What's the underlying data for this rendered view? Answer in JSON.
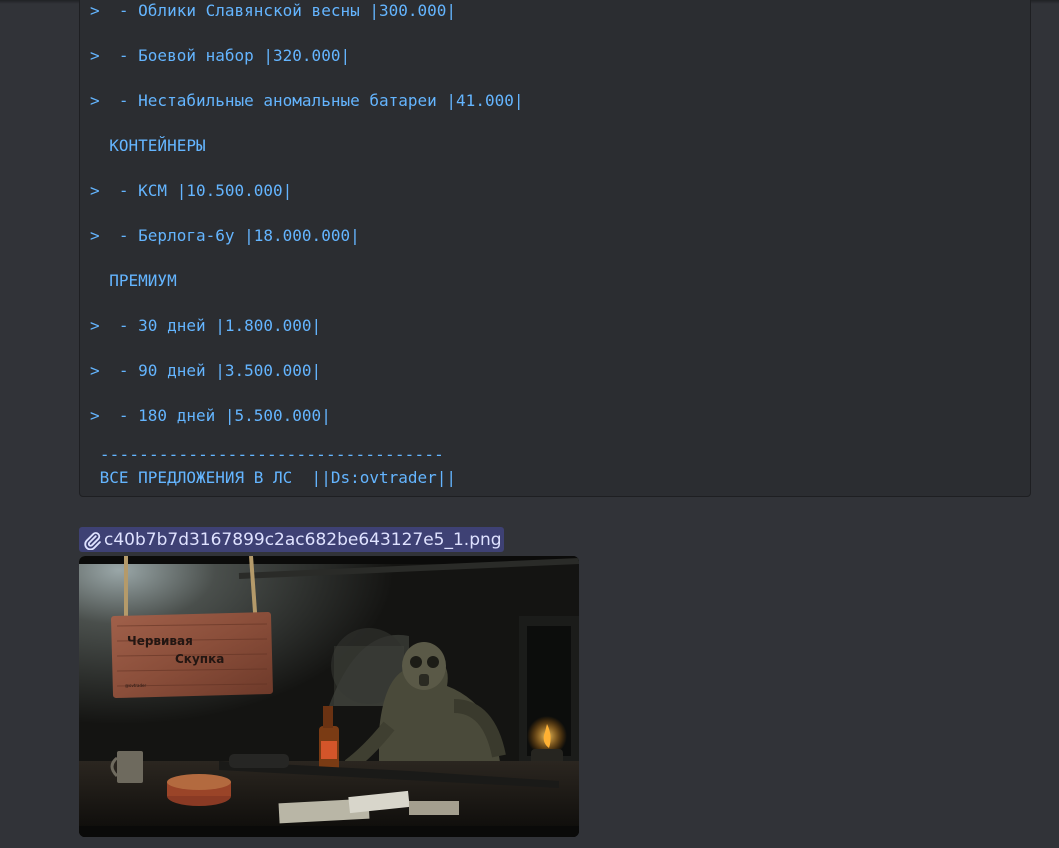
{
  "message": {
    "code_lines": [
      {
        "text": ">  - Облики Славянской весны |300.000|",
        "kind": "quote"
      },
      {
        "text": ">  - Боевой набор |320.000|",
        "kind": "quote"
      },
      {
        "text": ">  - Нестабильные аномальные батареи |41.000|",
        "kind": "quote"
      },
      {
        "text": "  КОНТЕЙНЕРЫ",
        "kind": "heading"
      },
      {
        "text": ">  - КСМ |10.500.000|",
        "kind": "quote"
      },
      {
        "text": ">  - Берлога-6у |18.000.000|",
        "kind": "quote"
      },
      {
        "text": "  ПРЕМИУМ",
        "kind": "heading"
      },
      {
        "text": ">  - 30 дней |1.800.000|",
        "kind": "quote"
      },
      {
        "text": ">  - 90 дней |3.500.000|",
        "kind": "quote"
      },
      {
        "text": ">  - 180 дней |5.500.000|",
        "kind": "quote"
      }
    ],
    "divider": " -----------------------------------",
    "footer": " ВСЕ ПРЕДЛОЖЕНИЯ В ЛС  ||Ds:ovtrader||"
  },
  "attachment": {
    "filename": "c40b7b7d3167899c2ac682be643127e5_1.png",
    "icon": "paperclip-icon",
    "image": {
      "sign_line1": "Червивая",
      "sign_line2": "Скупка",
      "sign_small": "@ovtrader"
    }
  },
  "colors": {
    "background": "#313338",
    "code_background": "#2b2d31",
    "code_text": "#64b5ff",
    "link_highlight": "#3e4174"
  }
}
